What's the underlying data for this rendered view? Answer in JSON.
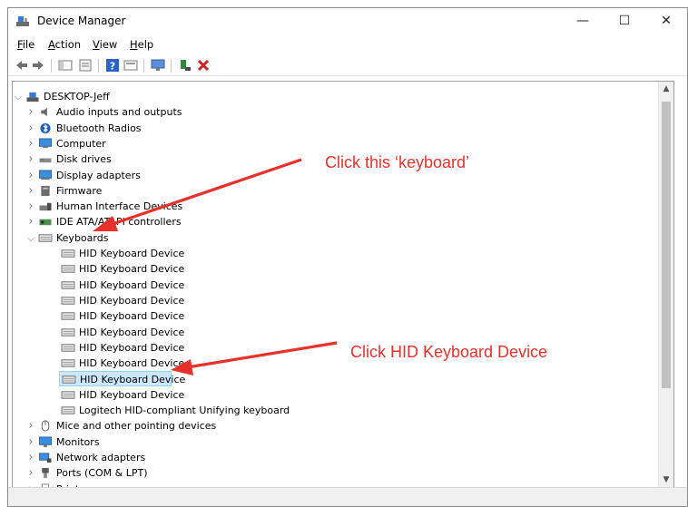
{
  "window": {
    "title": "Device Manager",
    "minimize": "—",
    "maximize": "☐",
    "close": "✕"
  },
  "menu": [
    {
      "letter": "F",
      "rest": "ile"
    },
    {
      "letter": "A",
      "rest": "ction"
    },
    {
      "letter": "V",
      "rest": "iew"
    },
    {
      "letter": "H",
      "rest": "elp"
    }
  ],
  "tree": {
    "root": "DESKTOP-Jeff",
    "categories_before": [
      {
        "label": "Audio inputs and outputs",
        "icon": "speaker-icon"
      },
      {
        "label": "Bluetooth Radios",
        "icon": "bluetooth-icon"
      },
      {
        "label": "Computer",
        "icon": "computer-icon"
      },
      {
        "label": "Disk drives",
        "icon": "disk-drive-icon"
      },
      {
        "label": "Display adapters",
        "icon": "display-adapter-icon"
      },
      {
        "label": "Firmware",
        "icon": "firmware-icon"
      },
      {
        "label": "Human Interface Devices",
        "icon": "hid-icon"
      },
      {
        "label": "IDE ATA/ATAPI controllers",
        "icon": "ide-controller-icon"
      }
    ],
    "keyboards": {
      "label": "Keyboards",
      "children": [
        "HID Keyboard Device",
        "HID Keyboard Device",
        "HID Keyboard Device",
        "HID Keyboard Device",
        "HID Keyboard Device",
        "HID Keyboard Device",
        "HID Keyboard Device",
        "HID Keyboard Device",
        "HID Keyboard Device",
        "HID Keyboard Device",
        "Logitech HID-compliant Unifying keyboard"
      ],
      "selected_index": 8
    },
    "categories_after": [
      {
        "label": "Mice and other pointing devices",
        "icon": "mouse-icon"
      },
      {
        "label": "Monitors",
        "icon": "monitor-icon"
      },
      {
        "label": "Network adapters",
        "icon": "network-adapter-icon"
      },
      {
        "label": "Ports (COM & LPT)",
        "icon": "port-icon"
      },
      {
        "label": "Print queues",
        "icon": "printer-icon"
      }
    ]
  },
  "annotations": {
    "keyboard": "Click this  ‘keyboard’",
    "device": "Click  HID Keyboard Device"
  },
  "colors": {
    "annotation": "#e8312b",
    "selection": "#cce8ff"
  }
}
